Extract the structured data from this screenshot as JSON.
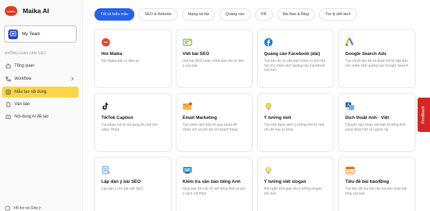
{
  "brand": {
    "logo_text": "maika",
    "name": "Maika AI"
  },
  "team": {
    "label": "My Team"
  },
  "sidebar": {
    "section_title": "KHÔNG GIAN LÀM VIỆC",
    "items": [
      {
        "label": "Tổng quan",
        "icon": "home-icon"
      },
      {
        "label": "Workflow",
        "icon": "workflow-icon",
        "chevron": "›"
      },
      {
        "label": "Mẫu tạo nội dung",
        "icon": "template-icon",
        "active": true
      },
      {
        "label": "Văn bản",
        "icon": "document-icon"
      },
      {
        "label": "Nội dung AI đã tạo",
        "icon": "ai-content-icon"
      }
    ],
    "support": "Hỗ trợ và Góp ý"
  },
  "tabs": [
    {
      "label": "Tất cả biểu mẫu",
      "active": true
    },
    {
      "label": "SEO & Website"
    },
    {
      "label": "Mạng xã hội"
    },
    {
      "label": "Quảng cáo"
    },
    {
      "label": "PR"
    },
    {
      "label": "Bài Báo & Blog"
    },
    {
      "label": "Trợ lý viết lách"
    }
  ],
  "cards": [
    {
      "title": "Hỏi Maika",
      "desc": "Hỏi Maika bất cứ điều gì",
      "icon": "maika-icon"
    },
    {
      "title": "Viết bài SEO",
      "desc": "Viết bài SEO hoàn chỉnh siêu tốc từ dàn ý của bạn",
      "icon": "seo-article-icon"
    },
    {
      "title": "Quảng cáo Facebook (dài)",
      "desc": "Tạo tiêu đề và văn bản chính có tính thu hút cho chiến dịch quảng cáo Facebook của bạn",
      "icon": "facebook-icon"
    },
    {
      "title": "Google Search Ads",
      "desc": "Tạo chuỗi tiêu đề và đoạn mô tả hấp dẫn cho chiến dịch quảng cáo Google Search",
      "icon": "google-ads-icon"
    },
    {
      "title": "TikTok Caption",
      "desc": "Tạo phần mô tả nội dung thu hút cho video Tiktok",
      "icon": "tiktok-icon"
    },
    {
      "title": "Email Marketing",
      "desc": "Tạo chiến dịch tiếp thị qua email để chăm sóc và kết nối với khách hàng",
      "icon": "email-icon"
    },
    {
      "title": "Ý tưởng mới",
      "desc": "Tạo một danh sách ý tưởng mới từ một chủ đề hay từ khóa",
      "icon": "idea-icon"
    },
    {
      "title": "Dịch thuật Anh - Việt",
      "desc": "Chuyển ngữ đoạn văn bản từ tiếng Anh sang tiếng Việt và ngược lại",
      "icon": "translate-icon"
    },
    {
      "title": "Lập dàn ý bài SEO",
      "desc": "Lập dàn ý cho bài viết SEO",
      "icon": "outline-icon"
    },
    {
      "title": "Kiểm tra văn bản tiếng Anh",
      "desc": "Giúp bạn tìm các lỗi viết tiếng Anh và gợi ý cách cải thiện",
      "icon": "english-check-icon"
    },
    {
      "title": "Ý tưởng viết slogan",
      "desc": "Rút ngắn thời gian lên ý tưởng slogan cho bạn",
      "icon": "slogan-icon"
    },
    {
      "title": "Tiêu đề bài báo/Blog",
      "desc": "Tạo tiêu đề thu hút cho bài báo hoặc bài blog của bạn",
      "icon": "headline-icon"
    }
  ],
  "feedback": {
    "label": "Feedback"
  }
}
